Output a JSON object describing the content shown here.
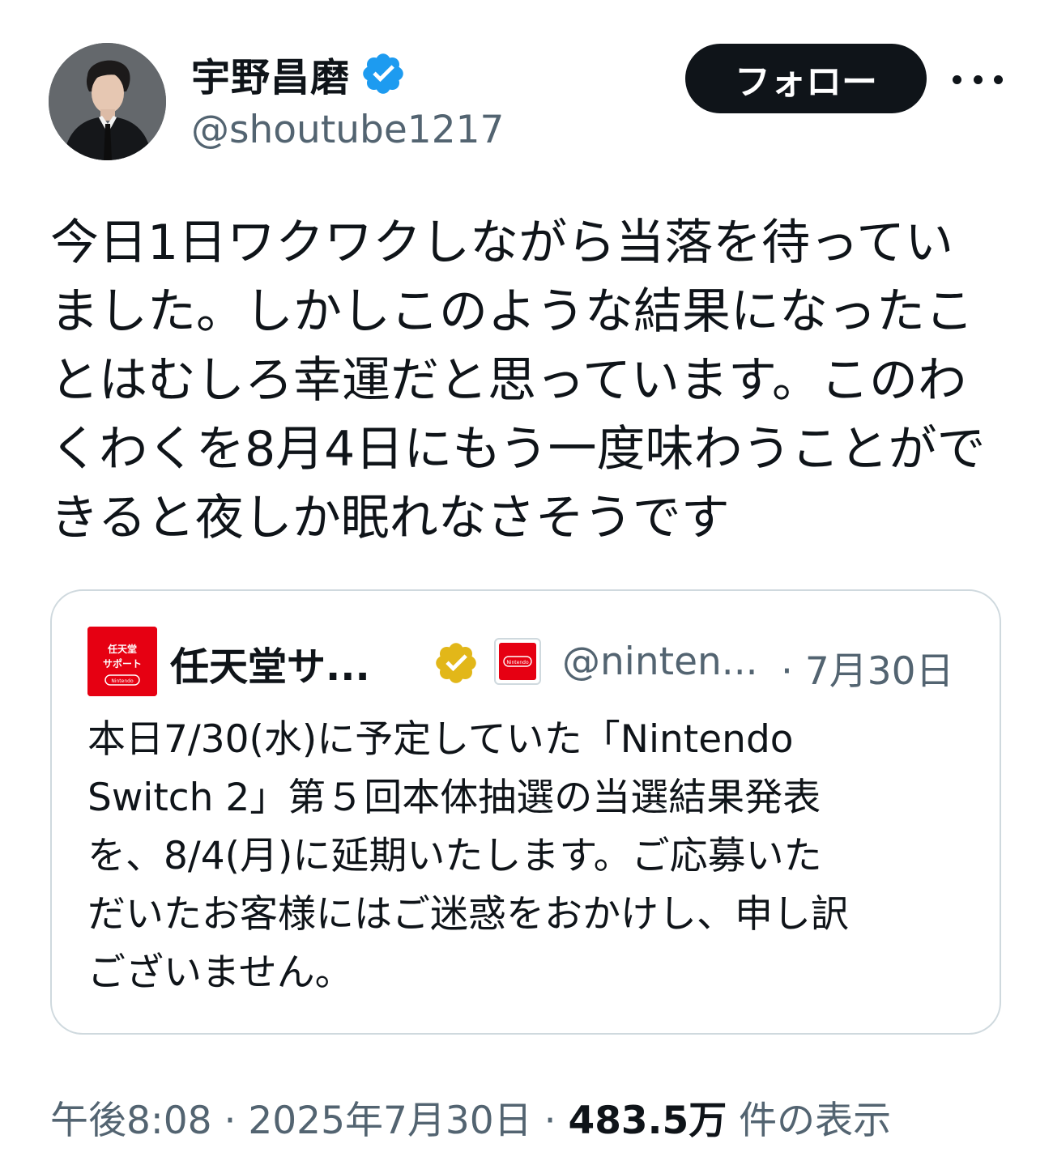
{
  "author": {
    "display_name": "宇野昌磨",
    "handle": "@shoutube1217",
    "verified_icon": "blue-check-badge",
    "avatar": "profile-photo"
  },
  "actions": {
    "follow_label": "フォロー",
    "more_icon": "more-horizontal-icon"
  },
  "tweet": {
    "text": "今日1日ワクワクしながら当落を待ってい\nました。しかしこのような結果になったこ\nとはむしろ幸運だと思っています。このわ\nくわくを8月4日にもう一度味わうことがで\nきると夜しか眠れなさそうです"
  },
  "quote": {
    "display_name": "任天堂サ...",
    "handle": "@ninten...",
    "date": "· 7月30日",
    "avatar_text_line1": "任天堂",
    "avatar_text_line2": "サポート",
    "avatar_brand": "Nintendo",
    "affiliate_brand": "Nintendo",
    "verified_icon": "gold-check-badge",
    "text": "本日7/30(水)に予定していた「Nintendo\nSwitch 2」第５回本体抽選の当選結果発表\nを、8/4(月)に延期いたします。ご応募いた\nだいたお客様にはご迷惑をおかけし、申し訳\nございません。"
  },
  "footer": {
    "time": "午後8:08",
    "separator1": " · ",
    "date": "2025年7月30日",
    "separator2": " · ",
    "views_count": "483.5万",
    "views_label": " 件の表示"
  },
  "colors": {
    "text_primary": "#0f1419",
    "text_secondary": "#536471",
    "verified_blue": "#1d9bf0",
    "verified_gold": "#e2b719",
    "nintendo_red": "#e60012",
    "border": "#cfd9de"
  }
}
